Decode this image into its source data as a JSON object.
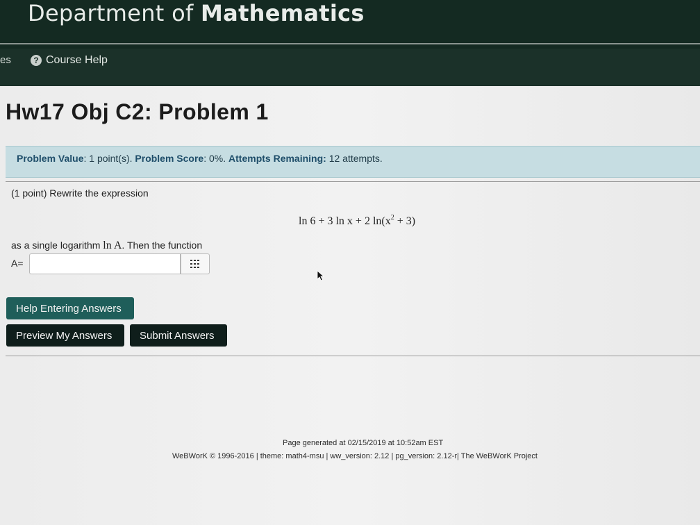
{
  "header": {
    "dept_prefix": "Department of ",
    "dept_name": "Mathematics"
  },
  "nav": {
    "cut_item": "es",
    "help_icon": "?",
    "course_help": "Course Help"
  },
  "problem": {
    "title": "Hw17 Obj C2: Problem 1",
    "info": {
      "value_label": "Problem Value",
      "value_text": ": 1 point(s). ",
      "score_label": "Problem Score",
      "score_text": ": 0%. ",
      "attempts_label": "Attempts Remaining:",
      "attempts_text": " 12 attempts."
    },
    "intro": "(1 point) Rewrite the expression",
    "expression_part1": "ln 6 + 3 ln x + 2 ln(x",
    "expression_sup": "2",
    "expression_part2": " + 3)",
    "single_log_text": "as a single logarithm ",
    "single_log_math": "ln A",
    "single_log_tail": ". Then the function",
    "answer_label": "A=",
    "answer_value": "",
    "answer_placeholder": ""
  },
  "buttons": {
    "help": "Help Entering Answers",
    "preview": "Preview My Answers",
    "submit": "Submit Answers"
  },
  "footer": {
    "generated": "Page generated at 02/15/2019 at 10:52am EST",
    "version": "WeBWorK © 1996-2016 | theme: math4-msu | ww_version: 2.12 | pg_version: 2.12-r| The WeBWorK Project"
  },
  "colors": {
    "header_bg": "#142a22",
    "info_bar_bg": "#c6dde2",
    "help_button_bg": "#1f5e5a",
    "dark_button_bg": "#0f1e1b"
  },
  "icons": {
    "help": "question-circle-icon",
    "palette": "grid-icon",
    "cursor": "mouse-pointer-icon"
  }
}
